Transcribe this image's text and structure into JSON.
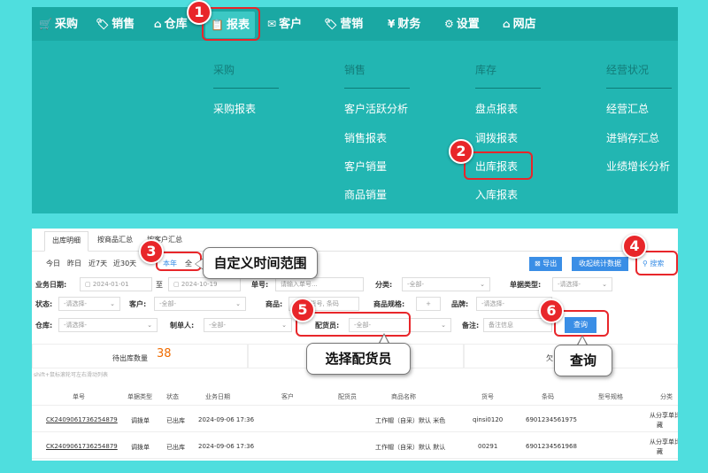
{
  "nav": {
    "items": [
      {
        "label": "采购",
        "icon": "cart-icon",
        "glyph": "🛒"
      },
      {
        "label": "销售",
        "icon": "tag-icon",
        "glyph": "🏷"
      },
      {
        "label": "仓库",
        "icon": "home-icon",
        "glyph": "⌂"
      },
      {
        "label": "报表",
        "icon": "clipboard-icon",
        "glyph": "📋"
      },
      {
        "label": "客户",
        "icon": "envelope-icon",
        "glyph": "✉"
      },
      {
        "label": "营销",
        "icon": "tags-icon",
        "glyph": "🏷"
      },
      {
        "label": "财务",
        "icon": "yen-icon",
        "glyph": "¥"
      },
      {
        "label": "设置",
        "icon": "gear-icon",
        "glyph": "⚙"
      },
      {
        "label": "网店",
        "icon": "shop-icon",
        "glyph": "⌂"
      }
    ]
  },
  "menu": {
    "columns": [
      {
        "title": "采购",
        "items": [
          "采购报表"
        ]
      },
      {
        "title": "销售",
        "items": [
          "客户活跃分析",
          "销售报表",
          "客户销量",
          "商品销量"
        ]
      },
      {
        "title": "库存",
        "items": [
          "盘点报表",
          "调拨报表",
          "出库报表",
          "入库报表"
        ]
      },
      {
        "title": "经营状况",
        "items": [
          "经营汇总",
          "进销存汇总",
          "业绩增长分析"
        ]
      }
    ]
  },
  "tabs": [
    "出库明细",
    "按商品汇总",
    "按客户汇总"
  ],
  "quick_dates": [
    "今日",
    "昨日",
    "近7天",
    "近30天",
    "本年",
    "全"
  ],
  "toolbar": {
    "export_label": "导出",
    "stats_label": "收起统计数据",
    "search_label": "搜索"
  },
  "filters": {
    "biz_date_label": "业务日期:",
    "date_start": "2024-01-01",
    "date_to": "至",
    "date_end": "2024-10-19",
    "order_no_label": "单号:",
    "order_no_placeholder": "请输入单号...",
    "category_label": "分类:",
    "category_value": "-全部-",
    "doc_type_label": "单据类型:",
    "doc_type_value": "-请选择-",
    "status_label": "状态:",
    "status_value": "-请选择-",
    "customer_label": "客户:",
    "customer_value": "-全部-",
    "product_label": "商品:",
    "product_placeholder": "名称, 货号, 条码",
    "spec_label": "商品规格:",
    "spec_value": "+",
    "brand_label": "品牌:",
    "brand_value": "-请选择-",
    "warehouse_label": "仓库:",
    "warehouse_value": "-请选择-",
    "maker_label": "制单人:",
    "maker_value": "-全部-",
    "picker_label": "配货员:",
    "picker_value": "-全部-",
    "remark_label": "备注:",
    "remark_placeholder": "备注信息",
    "query_label": "查询"
  },
  "summary": {
    "pending_label": "待出库数量",
    "pending_value": "38",
    "right_label": "欠"
  },
  "hint": "shift+鼠标滚轮可左右滑动列表",
  "table": {
    "headers": [
      "单号",
      "单据类型",
      "状态",
      "业务日期",
      "客户",
      "配货员",
      "商品名称",
      "货号",
      "条码",
      "型号规格",
      "分类"
    ],
    "rows": [
      {
        "order": "CK2409061736254879",
        "type": "调拨单",
        "status": "已出库",
        "date": "2024-09-06 17:36",
        "customer": "",
        "picker": "",
        "product": "工作帽（自采）默认 米色",
        "sku": "qinsi0120",
        "barcode": "6901234561975",
        "spec": "",
        "category_1": "从分享单比",
        "category_2": "藏"
      },
      {
        "order": "CK2409061736254879",
        "type": "调拨单",
        "status": "已出库",
        "date": "2024-09-06 17:36",
        "customer": "",
        "picker": "",
        "product": "工作帽（自采）默认 默认",
        "sku": "00291",
        "barcode": "6901234561968",
        "spec": "",
        "category_1": "从分享单比",
        "category_2": "藏"
      }
    ]
  },
  "annotations": {
    "badges": [
      "1",
      "2",
      "3",
      "4",
      "5",
      "6"
    ],
    "callout_time": "自定义时间范围",
    "callout_picker": "选择配货员",
    "callout_query": "查询"
  },
  "colors": {
    "nav_bg": "#1aa8a3",
    "menu_bg": "#22b6b2",
    "page_bg": "#4fdede",
    "accent_red": "#e8262a",
    "accent_blue": "#3a8ee6",
    "value_orange": "#f06c00"
  }
}
